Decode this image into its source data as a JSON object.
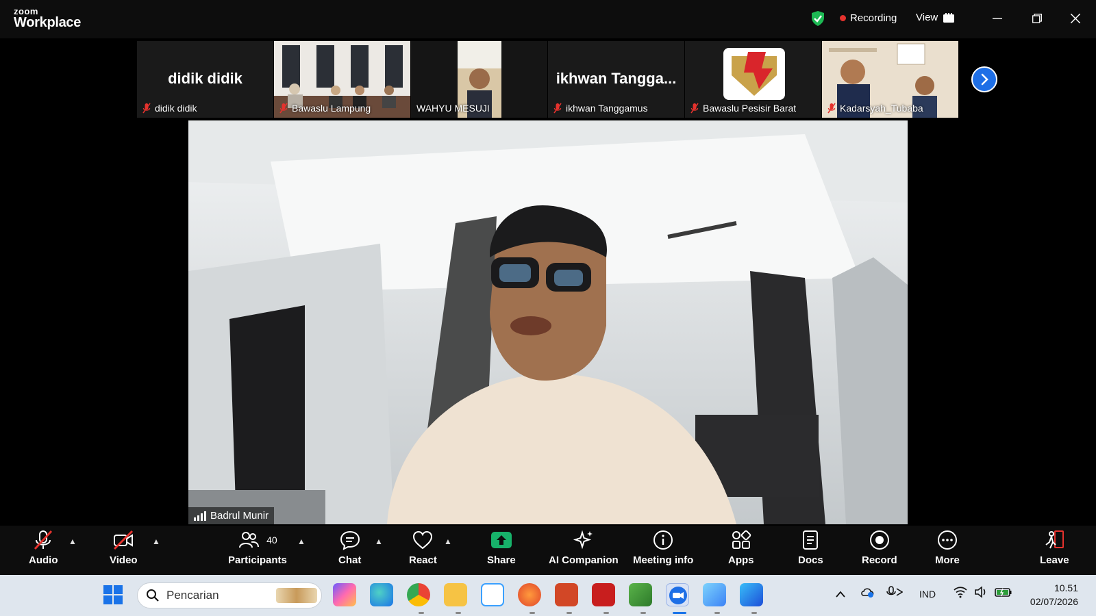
{
  "app": {
    "brand_top": "zoom",
    "brand_bottom": "Workplace"
  },
  "titlebar": {
    "recording_label": "Recording",
    "view_label": "View"
  },
  "participants_strip": [
    {
      "name": "didik didik",
      "display": "didik didik",
      "muted": true,
      "has_video": false
    },
    {
      "name": "Bawaslu Lampung",
      "muted": true,
      "has_video": true
    },
    {
      "name": "WAHYU MESUJI",
      "muted": false,
      "has_video": true
    },
    {
      "name": "ikhwan Tanggamus",
      "display": "ikhwan  Tangga...",
      "muted": true,
      "has_video": false
    },
    {
      "name": "Bawaslu Pesisir Barat",
      "muted": true,
      "has_video": true
    },
    {
      "name": "Kadarsyah_Tubaba",
      "muted": true,
      "has_video": true
    }
  ],
  "main_speaker": {
    "name": "Badrul Munir"
  },
  "toolbar": {
    "audio": "Audio",
    "video": "Video",
    "participants": "Participants",
    "participants_count": "40",
    "chat": "Chat",
    "react": "React",
    "share": "Share",
    "ai_companion": "AI Companion",
    "meeting_info": "Meeting info",
    "apps": "Apps",
    "docs": "Docs",
    "record": "Record",
    "more": "More",
    "leave": "Leave"
  },
  "taskbar": {
    "search_placeholder": "Pencarian",
    "language": "IND",
    "time": "10.51",
    "date": "02/07/2026"
  },
  "colors": {
    "accent_blue": "#1e6fe6",
    "share_green": "#17b26a",
    "recording_red": "#e5322d",
    "mute_red": "#e5322d"
  }
}
